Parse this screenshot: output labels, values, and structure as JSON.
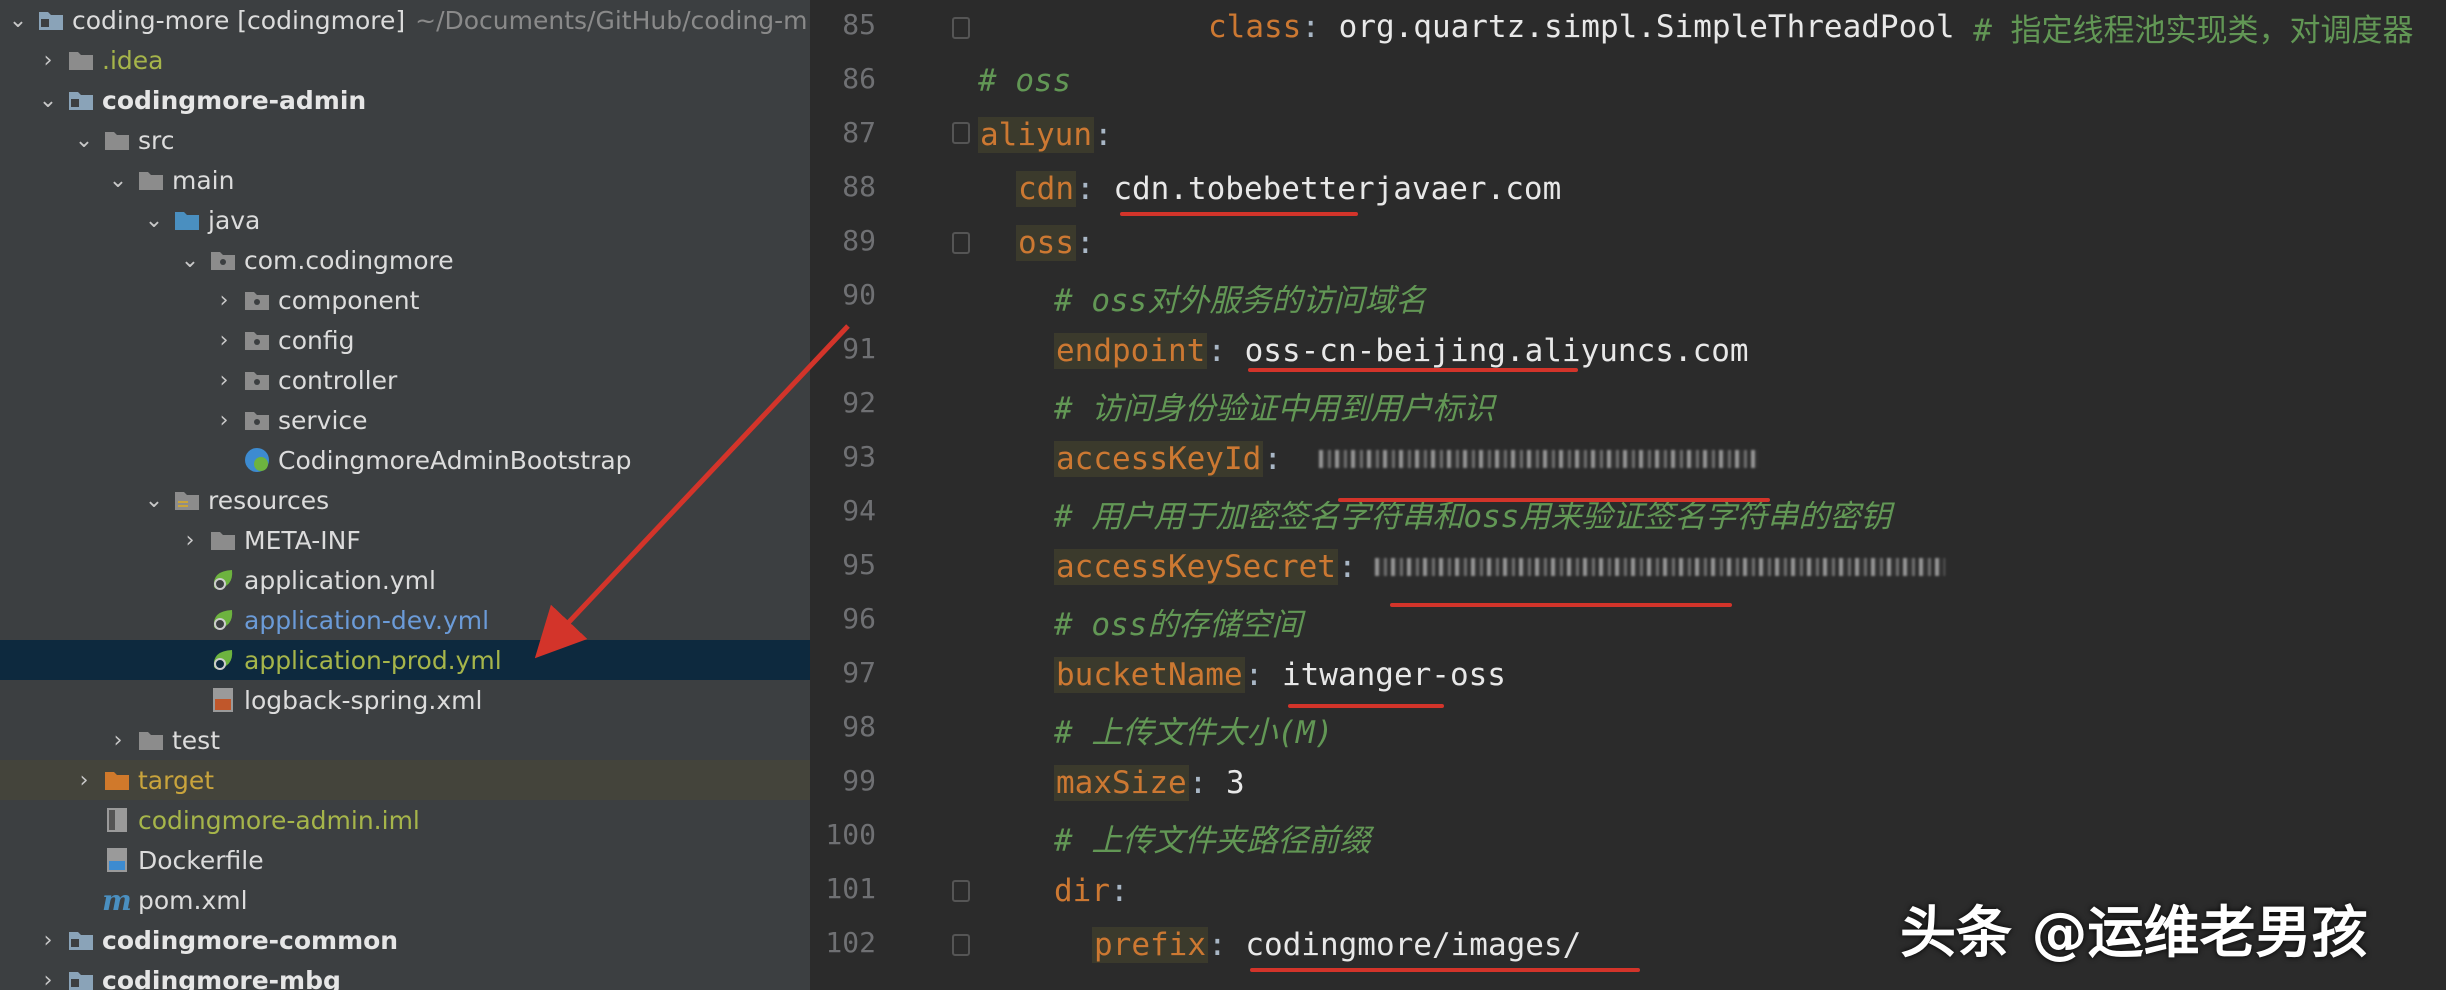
{
  "project_tree": {
    "rows": [
      {
        "label": "coding-more [codingmore]",
        "path": "~/Documents/GitHub/coding-m",
        "icon": "module-folder-icon",
        "style": "plain"
      },
      {
        "label": ".idea",
        "icon": "folder-icon",
        "style": "olive"
      },
      {
        "label": "codingmore-admin",
        "icon": "module-folder-icon",
        "style": "bold"
      },
      {
        "label": "src",
        "icon": "folder-icon",
        "style": "plain"
      },
      {
        "label": "main",
        "icon": "folder-icon",
        "style": "plain"
      },
      {
        "label": "java",
        "icon": "source-folder-icon",
        "style": "plain"
      },
      {
        "label": "com.codingmore",
        "icon": "package-icon",
        "style": "plain"
      },
      {
        "label": "component",
        "icon": "package-icon",
        "style": "plain"
      },
      {
        "label": "config",
        "icon": "package-icon",
        "style": "plain"
      },
      {
        "label": "controller",
        "icon": "package-icon",
        "style": "plain"
      },
      {
        "label": "service",
        "icon": "package-icon",
        "style": "plain"
      },
      {
        "label": "CodingmoreAdminBootstrap",
        "icon": "spring-boot-class-icon",
        "style": "plain"
      },
      {
        "label": "resources",
        "icon": "resources-folder-icon",
        "style": "plain"
      },
      {
        "label": "META-INF",
        "icon": "folder-icon",
        "style": "plain"
      },
      {
        "label": "application.yml",
        "icon": "spring-yml-icon",
        "style": "plain"
      },
      {
        "label": "application-dev.yml",
        "icon": "spring-yml-icon",
        "style": "blue"
      },
      {
        "label": "application-prod.yml",
        "icon": "spring-yml-icon",
        "style": "olive"
      },
      {
        "label": "logback-spring.xml",
        "icon": "xml-file-icon",
        "style": "plain"
      },
      {
        "label": "test",
        "icon": "folder-icon",
        "style": "plain"
      },
      {
        "label": "target",
        "icon": "excluded-folder-icon",
        "style": "orange"
      },
      {
        "label": "codingmore-admin.iml",
        "icon": "iml-file-icon",
        "style": "olive"
      },
      {
        "label": "Dockerfile",
        "icon": "docker-file-icon",
        "style": "plain"
      },
      {
        "label": "pom.xml",
        "icon": "maven-file-icon",
        "style": "plain"
      },
      {
        "label": "codingmore-common",
        "icon": "module-folder-icon",
        "style": "bold"
      },
      {
        "label": "codingmore-mbg",
        "icon": "module-folder-icon",
        "style": "bold"
      }
    ]
  },
  "editor": {
    "lines": [
      {
        "num": "85",
        "key": "class",
        "value": "org.quartz.simpl.SimpleThreadPool",
        "comment": "# 指定线程池实现类，对调度器"
      },
      {
        "num": "86",
        "comment": "# oss"
      },
      {
        "num": "87",
        "key": "aliyun"
      },
      {
        "num": "88",
        "key": "cdn",
        "value": "cdn.tobebetterjavaer.com"
      },
      {
        "num": "89",
        "key": "oss"
      },
      {
        "num": "90",
        "comment": "# oss对外服务的访问域名"
      },
      {
        "num": "91",
        "key": "endpoint",
        "value": "oss-cn-beijing.aliyuncs.com"
      },
      {
        "num": "92",
        "comment": "# 访问身份验证中用到用户标识"
      },
      {
        "num": "93",
        "key": "accessKeyId"
      },
      {
        "num": "94",
        "comment": "# 用户用于加密签名字符串和oss用来验证签名字符串的密钥"
      },
      {
        "num": "95",
        "key": "accessKeySecret"
      },
      {
        "num": "96",
        "comment": "# oss的存储空间"
      },
      {
        "num": "97",
        "key": "bucketName",
        "value": "itwanger-oss"
      },
      {
        "num": "98",
        "comment": "# 上传文件大小(M)"
      },
      {
        "num": "99",
        "key": "maxSize",
        "value": "3"
      },
      {
        "num": "100",
        "comment": "# 上传文件夹路径前缀"
      },
      {
        "num": "101",
        "key": "dir"
      },
      {
        "num": "102",
        "key": "prefix",
        "value": "codingmore/images/"
      }
    ]
  },
  "watermark": "头条 @运维老男孩",
  "colors": {
    "annotation_red": "#d3342a",
    "yaml_key": "#cc7832",
    "comment": "#629755"
  }
}
